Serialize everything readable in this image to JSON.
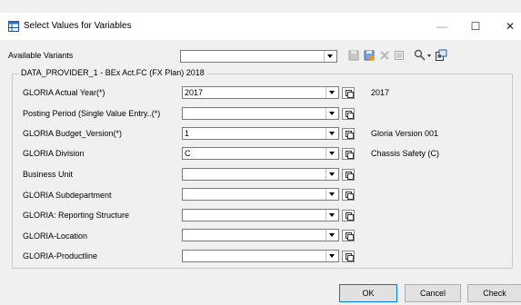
{
  "window": {
    "title": "Select Values for Variables",
    "min_glyph": "—",
    "max_glyph": "☐",
    "close_glyph": "✕"
  },
  "variants": {
    "label": "Available Variants",
    "value": ""
  },
  "group": {
    "title": "DATA_PROVIDER_1 - BEx Act.FC (FX Plan) 2018"
  },
  "rows": [
    {
      "label": "GLORIA Actual Year(*)",
      "value": "2017",
      "desc": "2017"
    },
    {
      "label": "Posting Period (Single Value Entry..(*)",
      "value": "",
      "desc": ""
    },
    {
      "label": "GLORIA Budget_Version(*)",
      "value": "1",
      "desc": "Gloria Version 001"
    },
    {
      "label": "GLORIA Division",
      "value": "C",
      "desc": "Chassis  Safety (C)"
    },
    {
      "label": "Business Unit",
      "value": "",
      "desc": ""
    },
    {
      "label": "GLORIA Subdepartment",
      "value": "",
      "desc": ""
    },
    {
      "label": "GLORIA: Reporting Structure",
      "value": "",
      "desc": ""
    },
    {
      "label": "GLORIA-Location",
      "value": "",
      "desc": ""
    },
    {
      "label": "GLORIA-Productline",
      "value": "",
      "desc": ""
    }
  ],
  "buttons": {
    "ok": "OK",
    "cancel": "Cancel",
    "check": "Check"
  },
  "colors": {
    "accent": "#0078d7",
    "background": "#f0f0f0"
  }
}
